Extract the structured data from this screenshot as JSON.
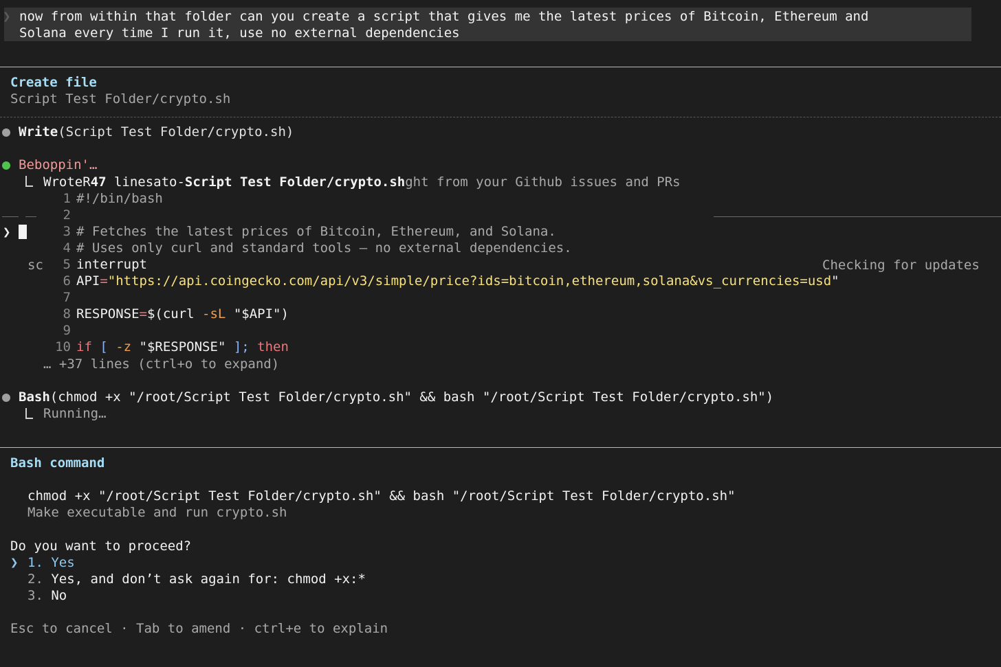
{
  "prompt": {
    "chevron": "❯",
    "line1": "now from within that folder can you create a script that gives me the latest prices of Bitcoin, Ethereum and",
    "line2": "Solana every time I run it, use no external dependencies"
  },
  "create_file": {
    "title": "Create file",
    "path": "Script Test Folder/crypto.sh"
  },
  "write_step": {
    "tool": "Write",
    "args": "(Script Test Folder/crypto.sh)"
  },
  "status": {
    "spinner_text": "Beboppin'…",
    "result_a": "WroteR",
    "result_count": "47",
    "result_b": " linesato-",
    "result_path": "Script Test Folder/crypto.sh",
    "result_c": "ght from your Github issues and PRs",
    "input_chevron": "❯",
    "sc_label": "sc",
    "checking_updates": "Checking for updates"
  },
  "code": {
    "l1": "#!/bin/bash",
    "l3": "# Fetches the latest prices of Bitcoin, Ethereum, and Solana.",
    "l4": "# Uses only curl and standard tools — no external dependencies.",
    "l5": "interrupt",
    "l6_var": "API",
    "l6_eq": "=",
    "l6_str": "\"https://api.coingecko.com/api/v3/simple/price?ids=bitcoin,ethereum,solana&vs_currencies=usd",
    "l6_end": "\"",
    "l8_var": "RESPONSE",
    "l8_eq": "=",
    "l8_open": "$(curl ",
    "l8_flag": "-sL",
    "l8_arg": " \"$API\")",
    "l10_if": "if",
    "l10_br": " [ ",
    "l10_flag": "-z",
    "l10_arg": " \"$RESPONSE\" ",
    "l10_close": "];",
    "l10_then": " then",
    "more": "… +37 lines (ctrl+o to expand)"
  },
  "bash_step": {
    "tool": "Bash",
    "args": "(chmod +x \"/root/Script Test Folder/crypto.sh\" && bash \"/root/Script Test Folder/crypto.sh\")",
    "running": "Running…"
  },
  "bash_command": {
    "title": "Bash command",
    "command": "chmod +x \"/root/Script Test Folder/crypto.sh\" && bash \"/root/Script Test Folder/crypto.sh\"",
    "description": "Make executable and run crypto.sh",
    "question": "Do you want to proceed?",
    "selector": "❯",
    "options": [
      {
        "num": "1.",
        "label": "Yes"
      },
      {
        "num": "2.",
        "label": "Yes, and don’t ask again for: chmod +x:*"
      },
      {
        "num": "3.",
        "label": "No"
      }
    ],
    "hint": "Esc to cancel · Tab to amend · ctrl+e to explain"
  },
  "colors": {
    "background": "#1e1e1e",
    "accent_cyan": "#a6def7",
    "status_green": "#4ec44e",
    "dot_grey": "#a0a0a0",
    "spinner_pink": "#f39a9a",
    "string_yellow": "#f7e27d"
  }
}
